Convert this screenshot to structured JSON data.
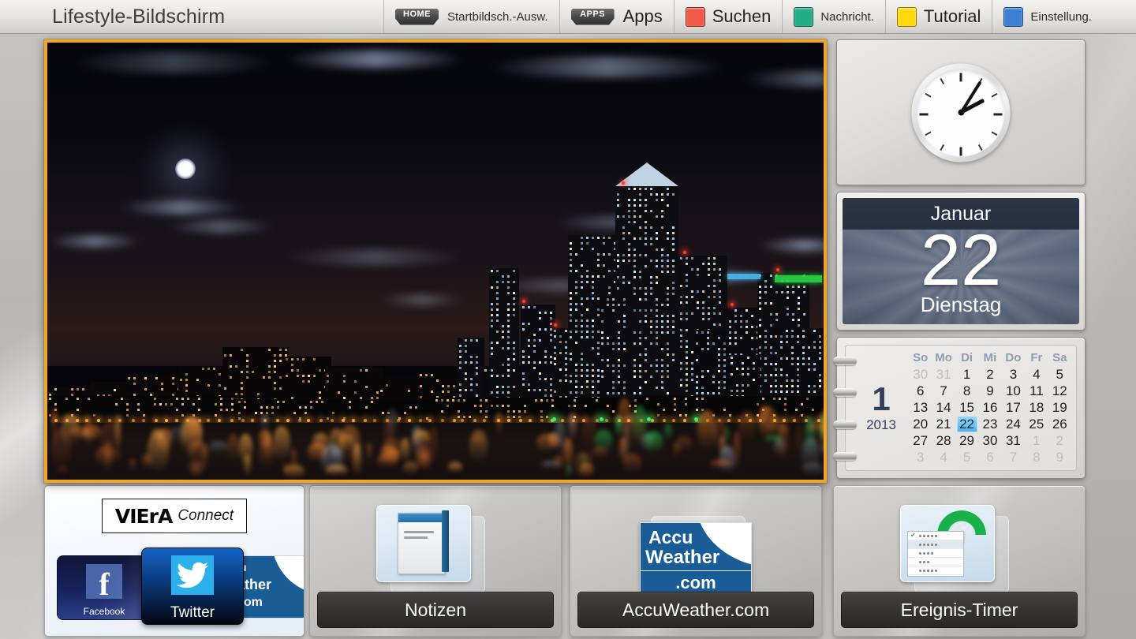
{
  "header": {
    "title": "Lifestyle-Bildschirm",
    "nav": [
      {
        "label": "Startbildsch.-Ausw.",
        "badge": "HOME",
        "type": "badge",
        "size": "small"
      },
      {
        "label": "Apps",
        "badge": "APPS",
        "type": "badge",
        "size": "big"
      },
      {
        "label": "Suchen",
        "color": "#f0594a",
        "type": "square",
        "size": "big"
      },
      {
        "label": "Nachricht.",
        "color": "#23ad86",
        "type": "square",
        "size": "small"
      },
      {
        "label": "Tutorial",
        "color": "#ffd80d",
        "type": "square",
        "size": "big"
      },
      {
        "label": "Einstellung.",
        "color": "#3d7fd4",
        "type": "square",
        "size": "small"
      }
    ]
  },
  "photo": {
    "name": "night-city-skyline-photo",
    "selected_border_color": "#f0a62a"
  },
  "clock": {
    "name": "analog-clock-widget",
    "hour_angle": 62,
    "minute_angle": 32,
    "time_reading": "2:05"
  },
  "date_widget": {
    "month": "Januar",
    "day": "22",
    "weekday": "Dienstag"
  },
  "calendar": {
    "month_number": "1",
    "year": "2013",
    "weekdays": [
      "So",
      "Mo",
      "Di",
      "Mi",
      "Do",
      "Fr",
      "Sa"
    ],
    "selected_day": "22",
    "days": [
      {
        "n": "30",
        "out": true
      },
      {
        "n": "31",
        "out": true
      },
      {
        "n": "1"
      },
      {
        "n": "2"
      },
      {
        "n": "3"
      },
      {
        "n": "4"
      },
      {
        "n": "5"
      },
      {
        "n": "6"
      },
      {
        "n": "7"
      },
      {
        "n": "8"
      },
      {
        "n": "9"
      },
      {
        "n": "10"
      },
      {
        "n": "11"
      },
      {
        "n": "12"
      },
      {
        "n": "13"
      },
      {
        "n": "14"
      },
      {
        "n": "15"
      },
      {
        "n": "16"
      },
      {
        "n": "17"
      },
      {
        "n": "18"
      },
      {
        "n": "19"
      },
      {
        "n": "20"
      },
      {
        "n": "21"
      },
      {
        "n": "22",
        "sel": true
      },
      {
        "n": "23"
      },
      {
        "n": "24"
      },
      {
        "n": "25"
      },
      {
        "n": "26"
      },
      {
        "n": "27"
      },
      {
        "n": "28"
      },
      {
        "n": "29"
      },
      {
        "n": "30"
      },
      {
        "n": "31"
      },
      {
        "n": "1",
        "out": true
      },
      {
        "n": "2",
        "out": true
      },
      {
        "n": "3",
        "out": true
      },
      {
        "n": "4",
        "out": true
      },
      {
        "n": "5",
        "out": true
      },
      {
        "n": "6",
        "out": true
      },
      {
        "n": "7",
        "out": true
      },
      {
        "n": "8",
        "out": true
      },
      {
        "n": "9",
        "out": true
      }
    ]
  },
  "viera_tile": {
    "logo_word": "VIErA",
    "logo_sub": "Connect",
    "apps": [
      {
        "label": "Facebook"
      },
      {
        "label": "Twitter"
      },
      {
        "label": "AccuWeather"
      }
    ],
    "accuweather_lines": [
      "u",
      "ather",
      "com"
    ]
  },
  "tiles": [
    {
      "label": "Notizen",
      "icon": "notes-icon"
    },
    {
      "label": "AccuWeather.com",
      "icon": "accuweather-icon"
    },
    {
      "label": "Ereignis-Timer",
      "icon": "event-timer-icon"
    }
  ],
  "accuweather_logo": {
    "line1": "Accu",
    "line2": "Weather",
    "line3": ".com"
  }
}
